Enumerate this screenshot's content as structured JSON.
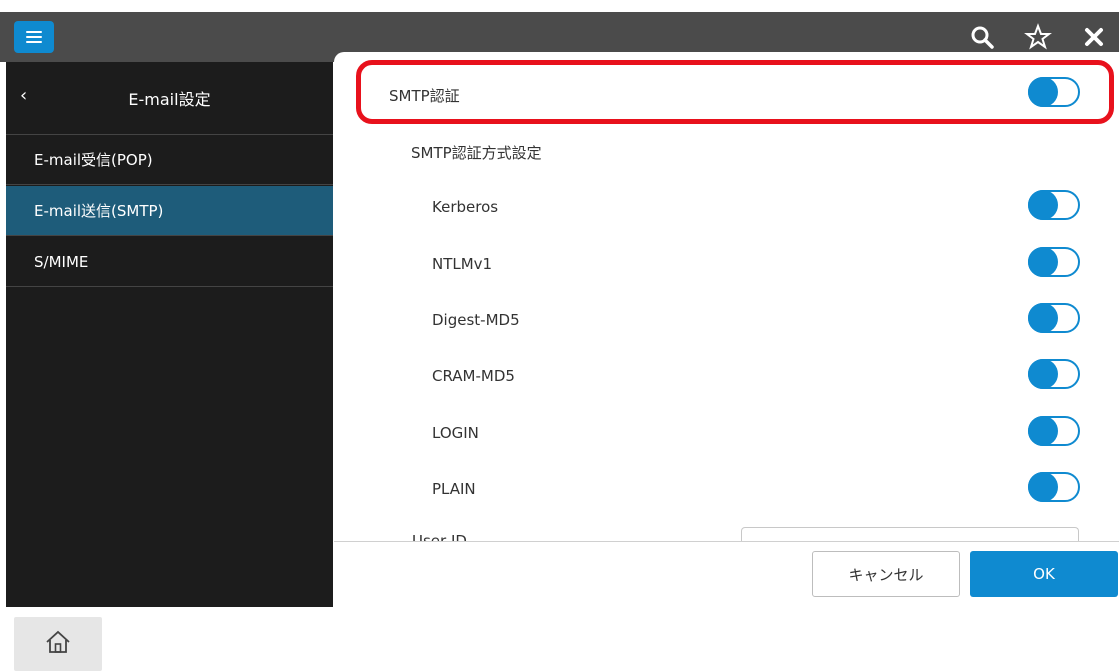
{
  "topbar": {
    "menu_icon": "hamburger-menu-icon",
    "search_icon": "search-icon",
    "favorite_icon": "star-icon",
    "close_icon": "close-icon"
  },
  "sidebar": {
    "back_icon": "chevron-left-icon",
    "title": "E-mail設定",
    "items": [
      {
        "label": "E-mail受信(POP)",
        "active": false
      },
      {
        "label": "E-mail送信(SMTP)",
        "active": true
      },
      {
        "label": "S/MIME",
        "active": false
      }
    ]
  },
  "main": {
    "smtp_auth": {
      "label": "SMTP認証",
      "on": true
    },
    "auth_method_heading": "SMTP認証方式設定",
    "methods": [
      {
        "label": "Kerberos",
        "on": true
      },
      {
        "label": "NTLMv1",
        "on": true
      },
      {
        "label": "Digest-MD5",
        "on": true
      },
      {
        "label": "CRAM-MD5",
        "on": true
      },
      {
        "label": "LOGIN",
        "on": true
      },
      {
        "label": "PLAIN",
        "on": true
      }
    ],
    "partial_field_label": "User ID"
  },
  "footer": {
    "cancel_label": "キャンセル",
    "ok_label": "OK"
  },
  "bottom": {
    "home_icon": "home-icon"
  },
  "colors": {
    "accent": "#0f8ad0",
    "highlight": "#e8111c",
    "topbar": "#4b4b4b",
    "sidebar": "#1c1c1c",
    "sidebar_active": "#1e5c7a"
  }
}
